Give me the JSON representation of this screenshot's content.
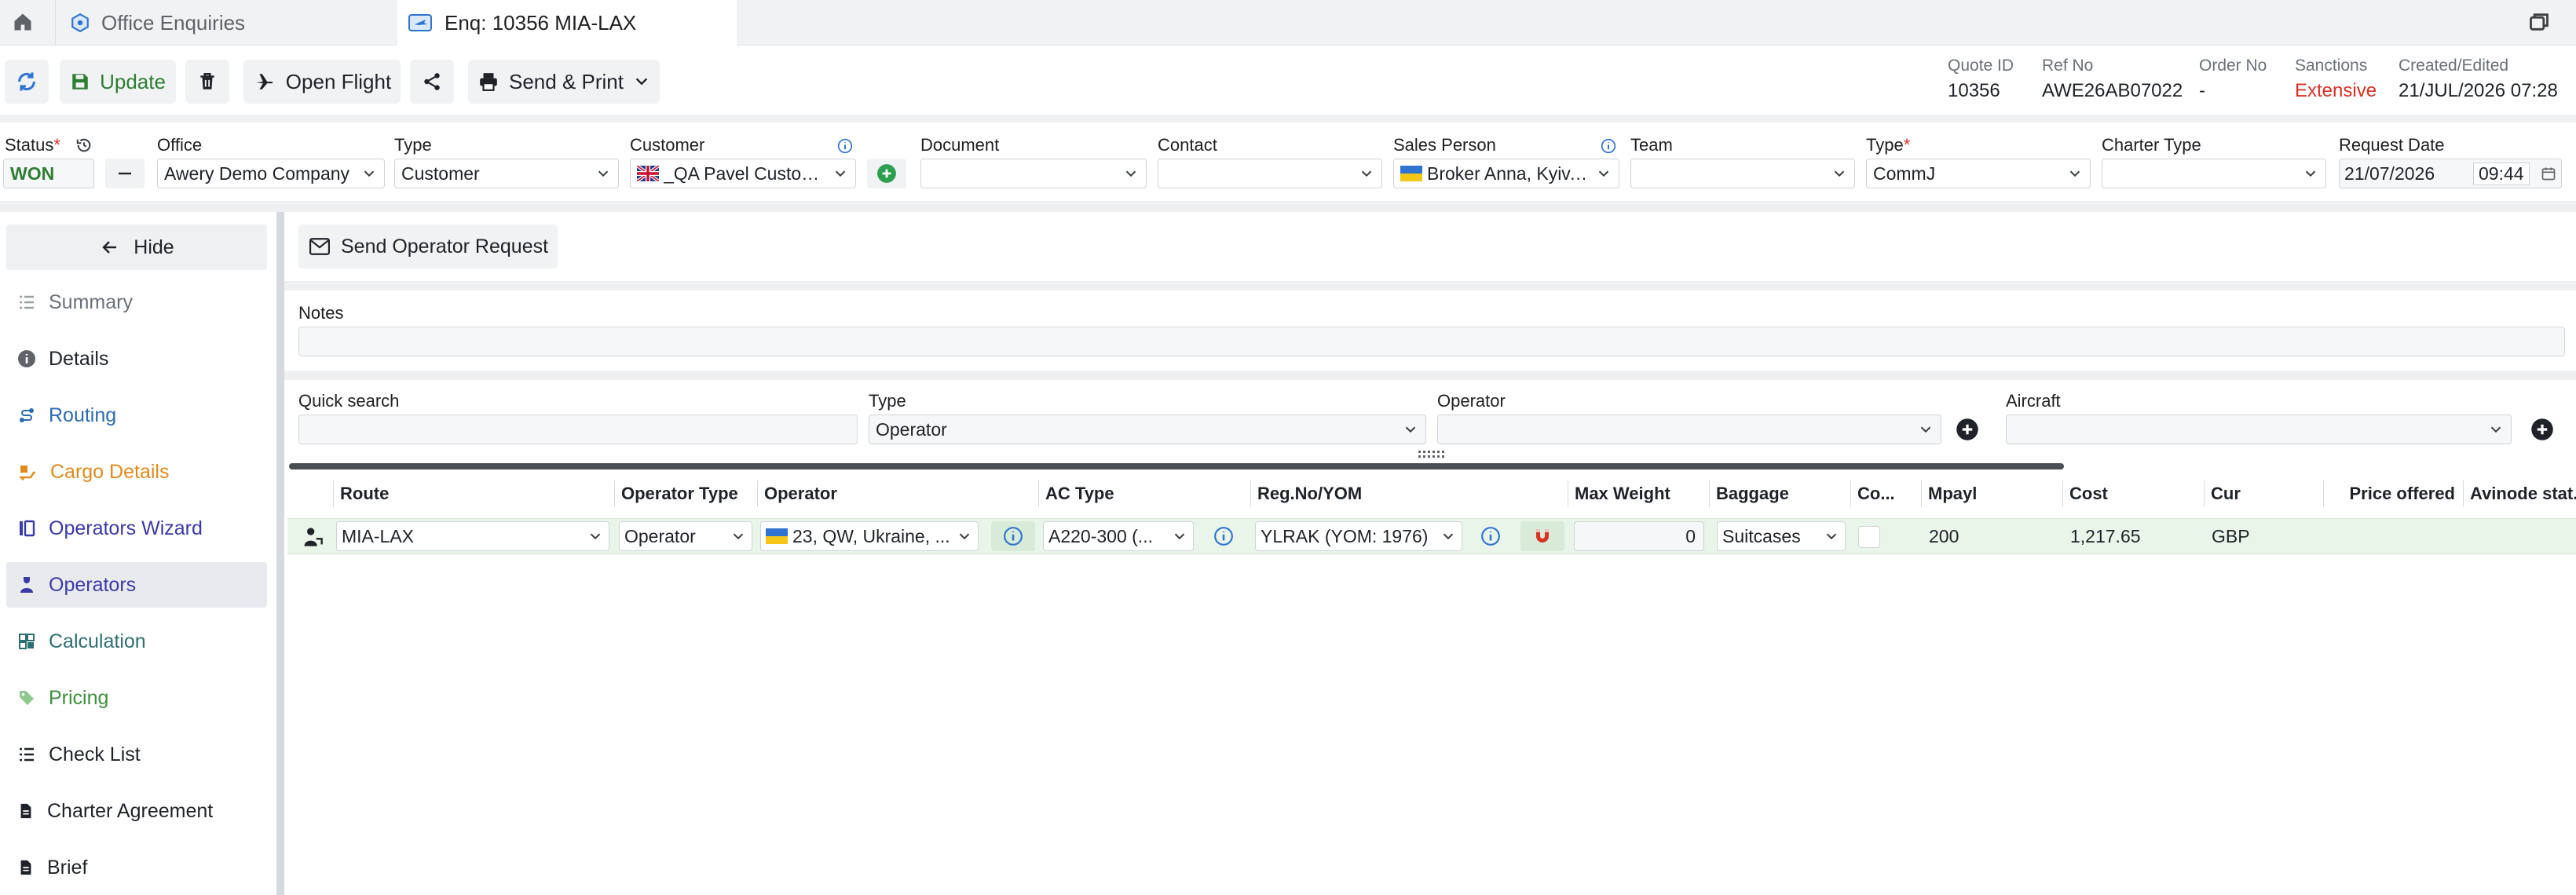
{
  "tabs": [
    {
      "label": "Office Enquiries",
      "icon": "hexagon-icon"
    },
    {
      "label": "Enq: 10356 MIA-LAX",
      "icon": "plane-card-icon"
    }
  ],
  "toolbar": {
    "update_label": "Update",
    "open_flight_label": "Open Flight",
    "send_print_label": "Send & Print"
  },
  "meta": [
    {
      "label": "Quote ID",
      "value": "10356"
    },
    {
      "label": "Ref No",
      "value": "AWE26AB07022"
    },
    {
      "label": "Order No",
      "value": "-"
    },
    {
      "label": "Sanctions",
      "value": "Extensive"
    },
    {
      "label": "Created/Edited",
      "value": "21/JUL/2026 07:28"
    }
  ],
  "form": {
    "status_label": "Status",
    "status_value": "WON",
    "office_label": "Office",
    "office_value": "Awery Demo Company",
    "type_label": "Type",
    "type_value": "Customer",
    "customer_label": "Customer",
    "customer_value": "_QA Pavel Custom...",
    "document_label": "Document",
    "document_value": "",
    "contact_label": "Contact",
    "contact_value": "",
    "sales_label": "Sales Person",
    "sales_value": "Broker Anna, Kyiv, ...",
    "team_label": "Team",
    "team_value": "",
    "type2_label": "Type",
    "type2_value": "CommJ",
    "charter_label": "Charter Type",
    "charter_value": "",
    "reqdate_label": "Request Date",
    "reqdate_value": "21/07/2026",
    "reqtime_value": "09:44"
  },
  "sidebar": {
    "hide_label": "Hide",
    "items": [
      {
        "label": "Summary",
        "color": "#6b7079"
      },
      {
        "label": "Details",
        "color": "#1f2329"
      },
      {
        "label": "Routing",
        "color": "#2a6bb0"
      },
      {
        "label": "Cargo Details",
        "color": "#e08a1e"
      },
      {
        "label": "Operators Wizard",
        "color": "#3a3aa8"
      },
      {
        "label": "Operators",
        "color": "#3a3aa8"
      },
      {
        "label": "Calculation",
        "color": "#2f6f73"
      },
      {
        "label": "Pricing",
        "color": "#3f8f3f"
      },
      {
        "label": "Check List",
        "color": "#1f2329"
      },
      {
        "label": "Charter Agreement",
        "color": "#1f2329"
      },
      {
        "label": "Brief",
        "color": "#1f2329"
      }
    ]
  },
  "content": {
    "send_request_label": "Send Operator Request",
    "notes_label": "Notes",
    "quick_search_label": "Quick search",
    "type_label": "Type",
    "type_value": "Operator",
    "operator_label": "Operator",
    "aircraft_label": "Aircraft"
  },
  "grid": {
    "columns": [
      "Route",
      "Operator Type",
      "Operator",
      "AC Type",
      "Reg.No/YOM",
      "Max Weight",
      "Baggage",
      "Co...",
      "Mpayl",
      "Cost",
      "Cur",
      "Price offered",
      "Avinode stat..."
    ],
    "row": {
      "route": "MIA-LAX",
      "operator_type": "Operator",
      "operator": "23, QW, Ukraine, ...",
      "ac_type": "A220-300 (...",
      "reg": "YLRAK (YOM: 1976)",
      "max_weight": "0",
      "baggage": "Suitcases",
      "mpayl": "200",
      "cost": "1,217.65",
      "cur": "GBP"
    }
  },
  "colors": {
    "accent_green": "#2e7d32",
    "sanctions_red": "#d93025",
    "link_blue": "#2a6bb0"
  }
}
